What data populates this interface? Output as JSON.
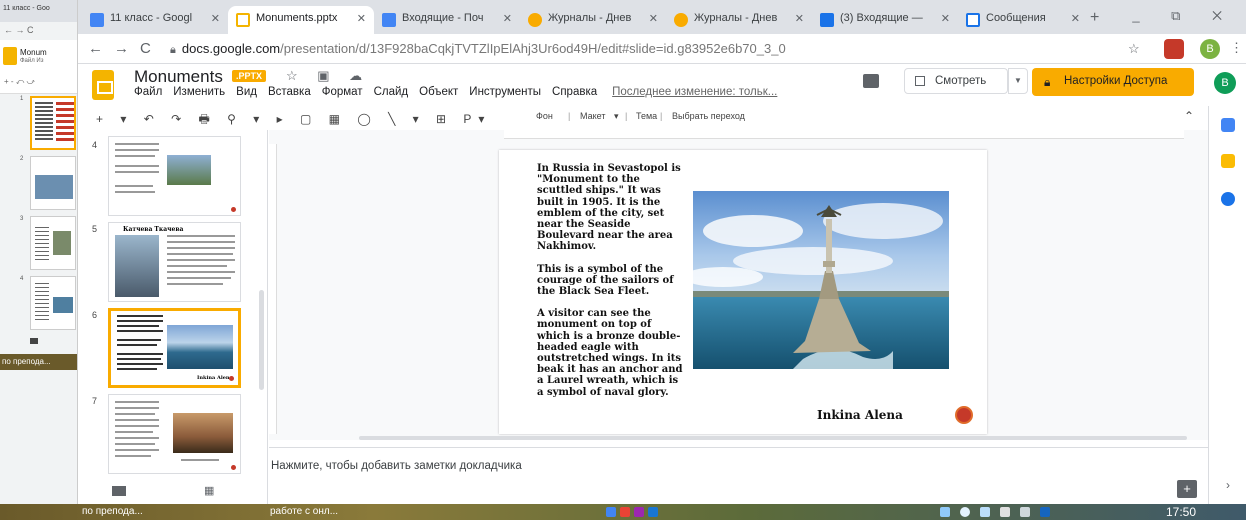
{
  "background_window": {
    "tab_title": "11 класс - Goo",
    "nav": "← → C",
    "title": "Monum",
    "menu": "Файл  Из",
    "tools": "+ - ⤺ ⤻",
    "task_label": "по препода..."
  },
  "browser": {
    "tabs": [
      {
        "label": "11 класс - Googl",
        "color": "#4285f4"
      },
      {
        "label": "Monuments.pptx",
        "color": "#f4b400"
      },
      {
        "label": "Входящие - Поч",
        "color": "#4285f4"
      },
      {
        "label": "Журналы - Днев",
        "color": "#f9ab00"
      },
      {
        "label": "Журналы - Днев",
        "color": "#f9ab00"
      },
      {
        "label": "(3) Входящие —",
        "color": "#1a73e8"
      },
      {
        "label": "Сообщения",
        "color": "#1a73e8"
      }
    ],
    "url_host": "docs.google.com",
    "url_path": "/presentation/d/13F928baCqkjTVTZlIpElAhj3Ur6od49H/edit#slide=id.g83952e6b70_3_0",
    "profile_letter": "B"
  },
  "app": {
    "doc_title": "Monuments",
    "badge": ".PPTX",
    "menu": [
      "Файл",
      "Изменить",
      "Вид",
      "Вставка",
      "Формат",
      "Слайд",
      "Объект",
      "Инструменты",
      "Справка"
    ],
    "last_edit": "Последнее изменение: тольк...",
    "view_button": "Смотреть",
    "share_button": "Настройки Доступа",
    "user_letter": "B"
  },
  "toolbar": {
    "background": "Фон",
    "layout": "Макет",
    "theme": "Тема",
    "transition": "Выбрать переход"
  },
  "filmstrip": {
    "slide_numbers": [
      "4",
      "5",
      "6",
      "7"
    ],
    "selected": "6",
    "thumb5_title": "Катчева Ткачева",
    "thumb6_author": "Inkina Alena"
  },
  "slide": {
    "paragraphs": [
      "In Russia in Sevastopol is \"Monument to the scuttled ships.\" It was built in 1905. It is the emblem of the city, set near the Seaside Boulevard near the area Nakhimov.",
      "This is a symbol of the courage of the sailors of the Black Sea Fleet.",
      "A visitor can see the monument on top of which is a bronze double-headed eagle with outstretched wings. In its beak it has an anchor and a Laurel wreath, which is a symbol of naval glory."
    ],
    "author": "Inkina Alena",
    "accent_color": "#c53929"
  },
  "notes": {
    "placeholder": "Нажмите, чтобы добавить заметки докладчика"
  },
  "taskbar": {
    "item1": "по препода...",
    "item2": "работе с онл...",
    "clock": "17:50"
  }
}
